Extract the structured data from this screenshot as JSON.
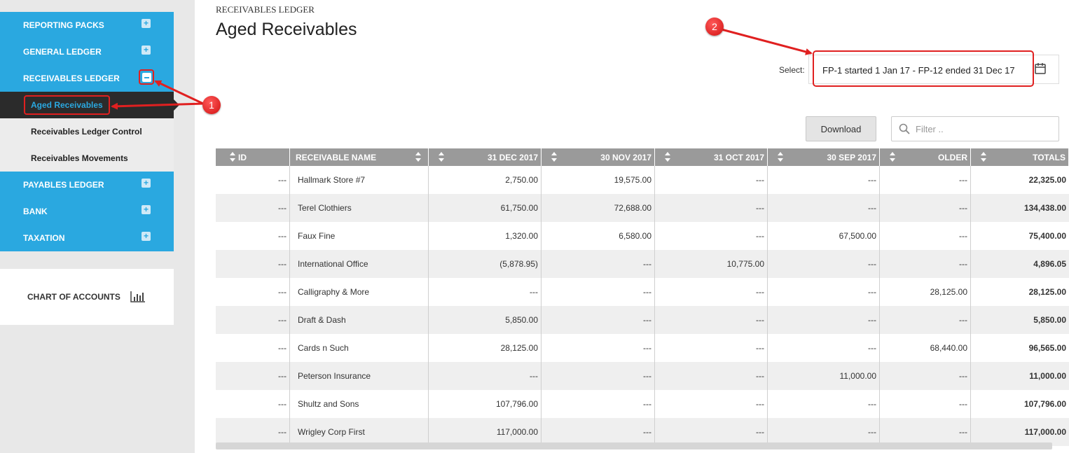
{
  "sidebar": {
    "items": [
      {
        "label": "REPORTING PACKS"
      },
      {
        "label": "GENERAL LEDGER"
      },
      {
        "label": "RECEIVABLES LEDGER"
      },
      {
        "label": "PAYABLES LEDGER"
      },
      {
        "label": "BANK"
      },
      {
        "label": "TAXATION"
      }
    ],
    "sub_items": [
      {
        "label": "Aged Receivables",
        "active": true
      },
      {
        "label": "Receivables Ledger Control"
      },
      {
        "label": "Receivables Movements"
      }
    ],
    "chart_of_accounts": "CHART OF ACCOUNTS"
  },
  "header": {
    "breadcrumb": "RECEIVABLES LEDGER",
    "title": "Aged Receivables"
  },
  "period": {
    "label": "Select:",
    "value": "FP-1 started 1 Jan 17 - FP-12 ended 31 Dec 17"
  },
  "toolbar": {
    "download_label": "Download",
    "filter_placeholder": "Filter .."
  },
  "table": {
    "columns": [
      "ID",
      "RECEIVABLE NAME",
      "31 DEC 2017",
      "30 NOV 2017",
      "31 OCT 2017",
      "30 SEP 2017",
      "OLDER",
      "TOTALS"
    ],
    "rows": [
      [
        "---",
        "Hallmark Store #7",
        "2,750.00",
        "19,575.00",
        "---",
        "---",
        "---",
        "22,325.00"
      ],
      [
        "---",
        "Terel Clothiers",
        "61,750.00",
        "72,688.00",
        "---",
        "---",
        "---",
        "134,438.00"
      ],
      [
        "---",
        "Faux Fine",
        "1,320.00",
        "6,580.00",
        "---",
        "67,500.00",
        "---",
        "75,400.00"
      ],
      [
        "---",
        "International Office",
        "(5,878.95)",
        "---",
        "10,775.00",
        "---",
        "---",
        "4,896.05"
      ],
      [
        "---",
        "Calligraphy & More",
        "---",
        "---",
        "---",
        "---",
        "28,125.00",
        "28,125.00"
      ],
      [
        "---",
        "Draft & Dash",
        "5,850.00",
        "---",
        "---",
        "---",
        "---",
        "5,850.00"
      ],
      [
        "---",
        "Cards n Such",
        "28,125.00",
        "---",
        "---",
        "---",
        "68,440.00",
        "96,565.00"
      ],
      [
        "---",
        "Peterson Insurance",
        "---",
        "---",
        "---",
        "11,000.00",
        "---",
        "11,000.00"
      ],
      [
        "---",
        "Shultz and Sons",
        "107,796.00",
        "---",
        "---",
        "---",
        "---",
        "107,796.00"
      ],
      [
        "---",
        "Wrigley Corp First",
        "117,000.00",
        "---",
        "---",
        "---",
        "---",
        "117,000.00"
      ]
    ]
  },
  "annotations": {
    "badge_1": "1",
    "badge_2": "2"
  },
  "colors": {
    "nav_blue": "#2aa8e0",
    "active_dark": "#2b2b2b",
    "header_gray": "#9a9a9a",
    "annotation_red": "#e02020"
  }
}
